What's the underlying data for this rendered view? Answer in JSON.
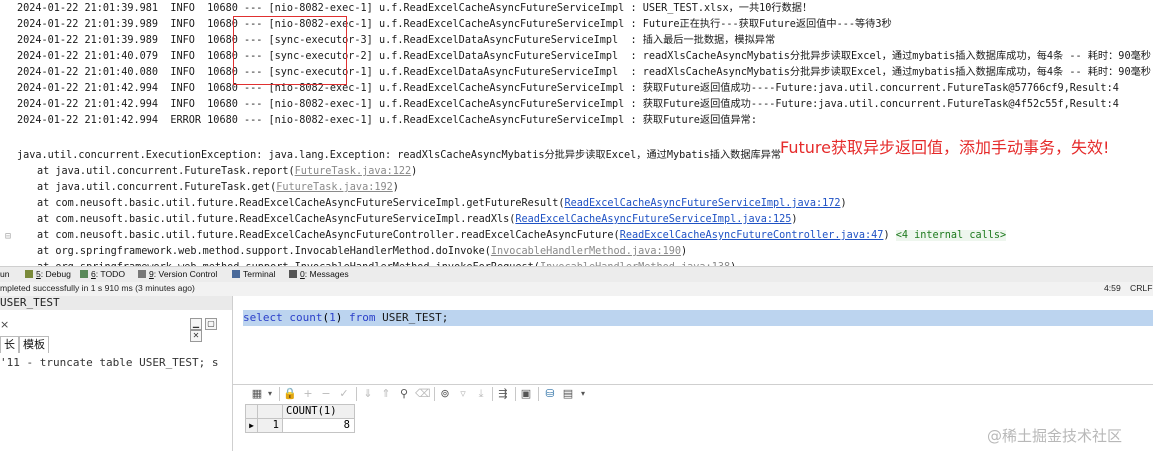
{
  "console": {
    "log_lines": [
      {
        "ts": "2024-01-22 21:01:39.981",
        "level": "INFO ",
        "pid": "10680",
        "thread": "[nio-8082-exec-1]",
        "logger": "u.f.ReadExcelCacheAsyncFutureServiceImpl",
        "msg": "USER_TEST.xlsx，一共10行数据！"
      },
      {
        "ts": "2024-01-22 21:01:39.989",
        "level": "INFO ",
        "pid": "10680",
        "thread": "[nio-8082-exec-1]",
        "logger": "u.f.ReadExcelCacheAsyncFutureServiceImpl",
        "msg": "Future正在执行---获取Future返回值中---等待3秒"
      },
      {
        "ts": "2024-01-22 21:01:39.989",
        "level": "INFO ",
        "pid": "10680",
        "thread": "[sync-executor-3]",
        "logger": "u.f.ReadExcelDataAsyncFutureServiceImpl ",
        "msg": "插入最后一批数据，模拟异常"
      },
      {
        "ts": "2024-01-22 21:01:40.079",
        "level": "INFO ",
        "pid": "10680",
        "thread": "[sync-executor-2]",
        "logger": "u.f.ReadExcelDataAsyncFutureServiceImpl ",
        "msg": "readXlsCacheAsyncMybatis分批异步读取Excel，通过mybatis插入数据库成功，每4条 -- 耗时：90毫秒"
      },
      {
        "ts": "2024-01-22 21:01:40.080",
        "level": "INFO ",
        "pid": "10680",
        "thread": "[sync-executor-1]",
        "logger": "u.f.ReadExcelDataAsyncFutureServiceImpl ",
        "msg": "readXlsCacheAsyncMybatis分批异步读取Excel，通过mybatis插入数据库成功，每4条 -- 耗时：90毫秒"
      },
      {
        "ts": "2024-01-22 21:01:42.994",
        "level": "INFO ",
        "pid": "10680",
        "thread": "[nio-8082-exec-1]",
        "logger": "u.f.ReadExcelCacheAsyncFutureServiceImpl",
        "msg": "获取Future返回值成功----Future:java.util.concurrent.FutureTask@57766cf9,Result:4"
      },
      {
        "ts": "2024-01-22 21:01:42.994",
        "level": "INFO ",
        "pid": "10680",
        "thread": "[nio-8082-exec-1]",
        "logger": "u.f.ReadExcelCacheAsyncFutureServiceImpl",
        "msg": "获取Future返回值成功----Future:java.util.concurrent.FutureTask@4f52c55f,Result:4"
      },
      {
        "ts": "2024-01-22 21:01:42.994",
        "level": "ERROR",
        "pid": "10680",
        "thread": "[nio-8082-exec-1]",
        "logger": "u.f.ReadExcelCacheAsyncFutureServiceImpl",
        "msg": "获取Future返回值异常:"
      }
    ],
    "separator": "---",
    "colon": ":",
    "exception_line": "java.util.concurrent.ExecutionException: java.lang.Exception: readXlsCacheAsyncMybatis分批异步读取Excel，通过Mybatis插入数据库异常",
    "stack": [
      {
        "prefix": "at java.util.concurrent.FutureTask.report(",
        "link": "FutureTask.java:122",
        "suffix": ")",
        "style": "grey"
      },
      {
        "prefix": "at java.util.concurrent.FutureTask.get(",
        "link": "FutureTask.java:192",
        "suffix": ")",
        "style": "grey"
      },
      {
        "prefix": "at com.neusoft.basic.util.future.ReadExcelCacheAsyncFutureServiceImpl.getFutureResult(",
        "link": "ReadExcelCacheAsyncFutureServiceImpl.java:172",
        "suffix": ")",
        "style": "blue"
      },
      {
        "prefix": "at com.neusoft.basic.util.future.ReadExcelCacheAsyncFutureServiceImpl.readXls(",
        "link": "ReadExcelCacheAsyncFutureServiceImpl.java:125",
        "suffix": ")",
        "style": "blue"
      },
      {
        "prefix": "at com.neusoft.basic.util.future.ReadExcelCacheAsyncFutureController.readExcelCacheAsyncFuture(",
        "link": "ReadExcelCacheAsyncFutureController.java:47",
        "suffix": ") ",
        "style": "blue",
        "hint": "<4 internal calls>"
      },
      {
        "prefix": "at org.springframework.web.method.support.InvocableHandlerMethod.doInvoke(",
        "link": "InvocableHandlerMethod.java:190",
        "suffix": ")",
        "style": "grey"
      },
      {
        "prefix": "at org.springframework.web.method.support.InvocableHandlerMethod.invokeForRequest(",
        "link": "InvocableHandlerMethod.java:138",
        "suffix": ")",
        "style": "grey"
      }
    ],
    "annotation": "Future获取异步返回值，添加手动事务，失效!"
  },
  "toolwindows": [
    {
      "mnemonic": "",
      "label": "un"
    },
    {
      "mnemonic": "5",
      "label": ": Debug"
    },
    {
      "mnemonic": "6",
      "label": ": TODO"
    },
    {
      "mnemonic": "9",
      "label": ": Version Control"
    },
    {
      "mnemonic": "",
      "label": "Terminal"
    },
    {
      "mnemonic": "0",
      "label": ": Messages"
    }
  ],
  "status": {
    "message": "mpleted successfully in 1 s 910 ms (3 minutes ago)",
    "position": "4:59",
    "line_sep": "CRLF"
  },
  "left_pane": {
    "title": "USER_TEST",
    "tabs": [
      "长",
      "模板"
    ],
    "text": "'11 - truncate table USER_TEST; s"
  },
  "editor": {
    "sql": {
      "kw1": "select",
      "fn": "count",
      "num": "1",
      "kw2": "from",
      "table": "USER_TEST;"
    }
  },
  "grid": {
    "column": "COUNT(1)",
    "row_no": "1",
    "value": "8"
  },
  "watermark": "@稀土掘金技术社区",
  "colors": {
    "annotation": "#e52b2b",
    "highlight_box": "#e03030",
    "selection": "#bcd4ef",
    "link": "#1f52c4"
  }
}
